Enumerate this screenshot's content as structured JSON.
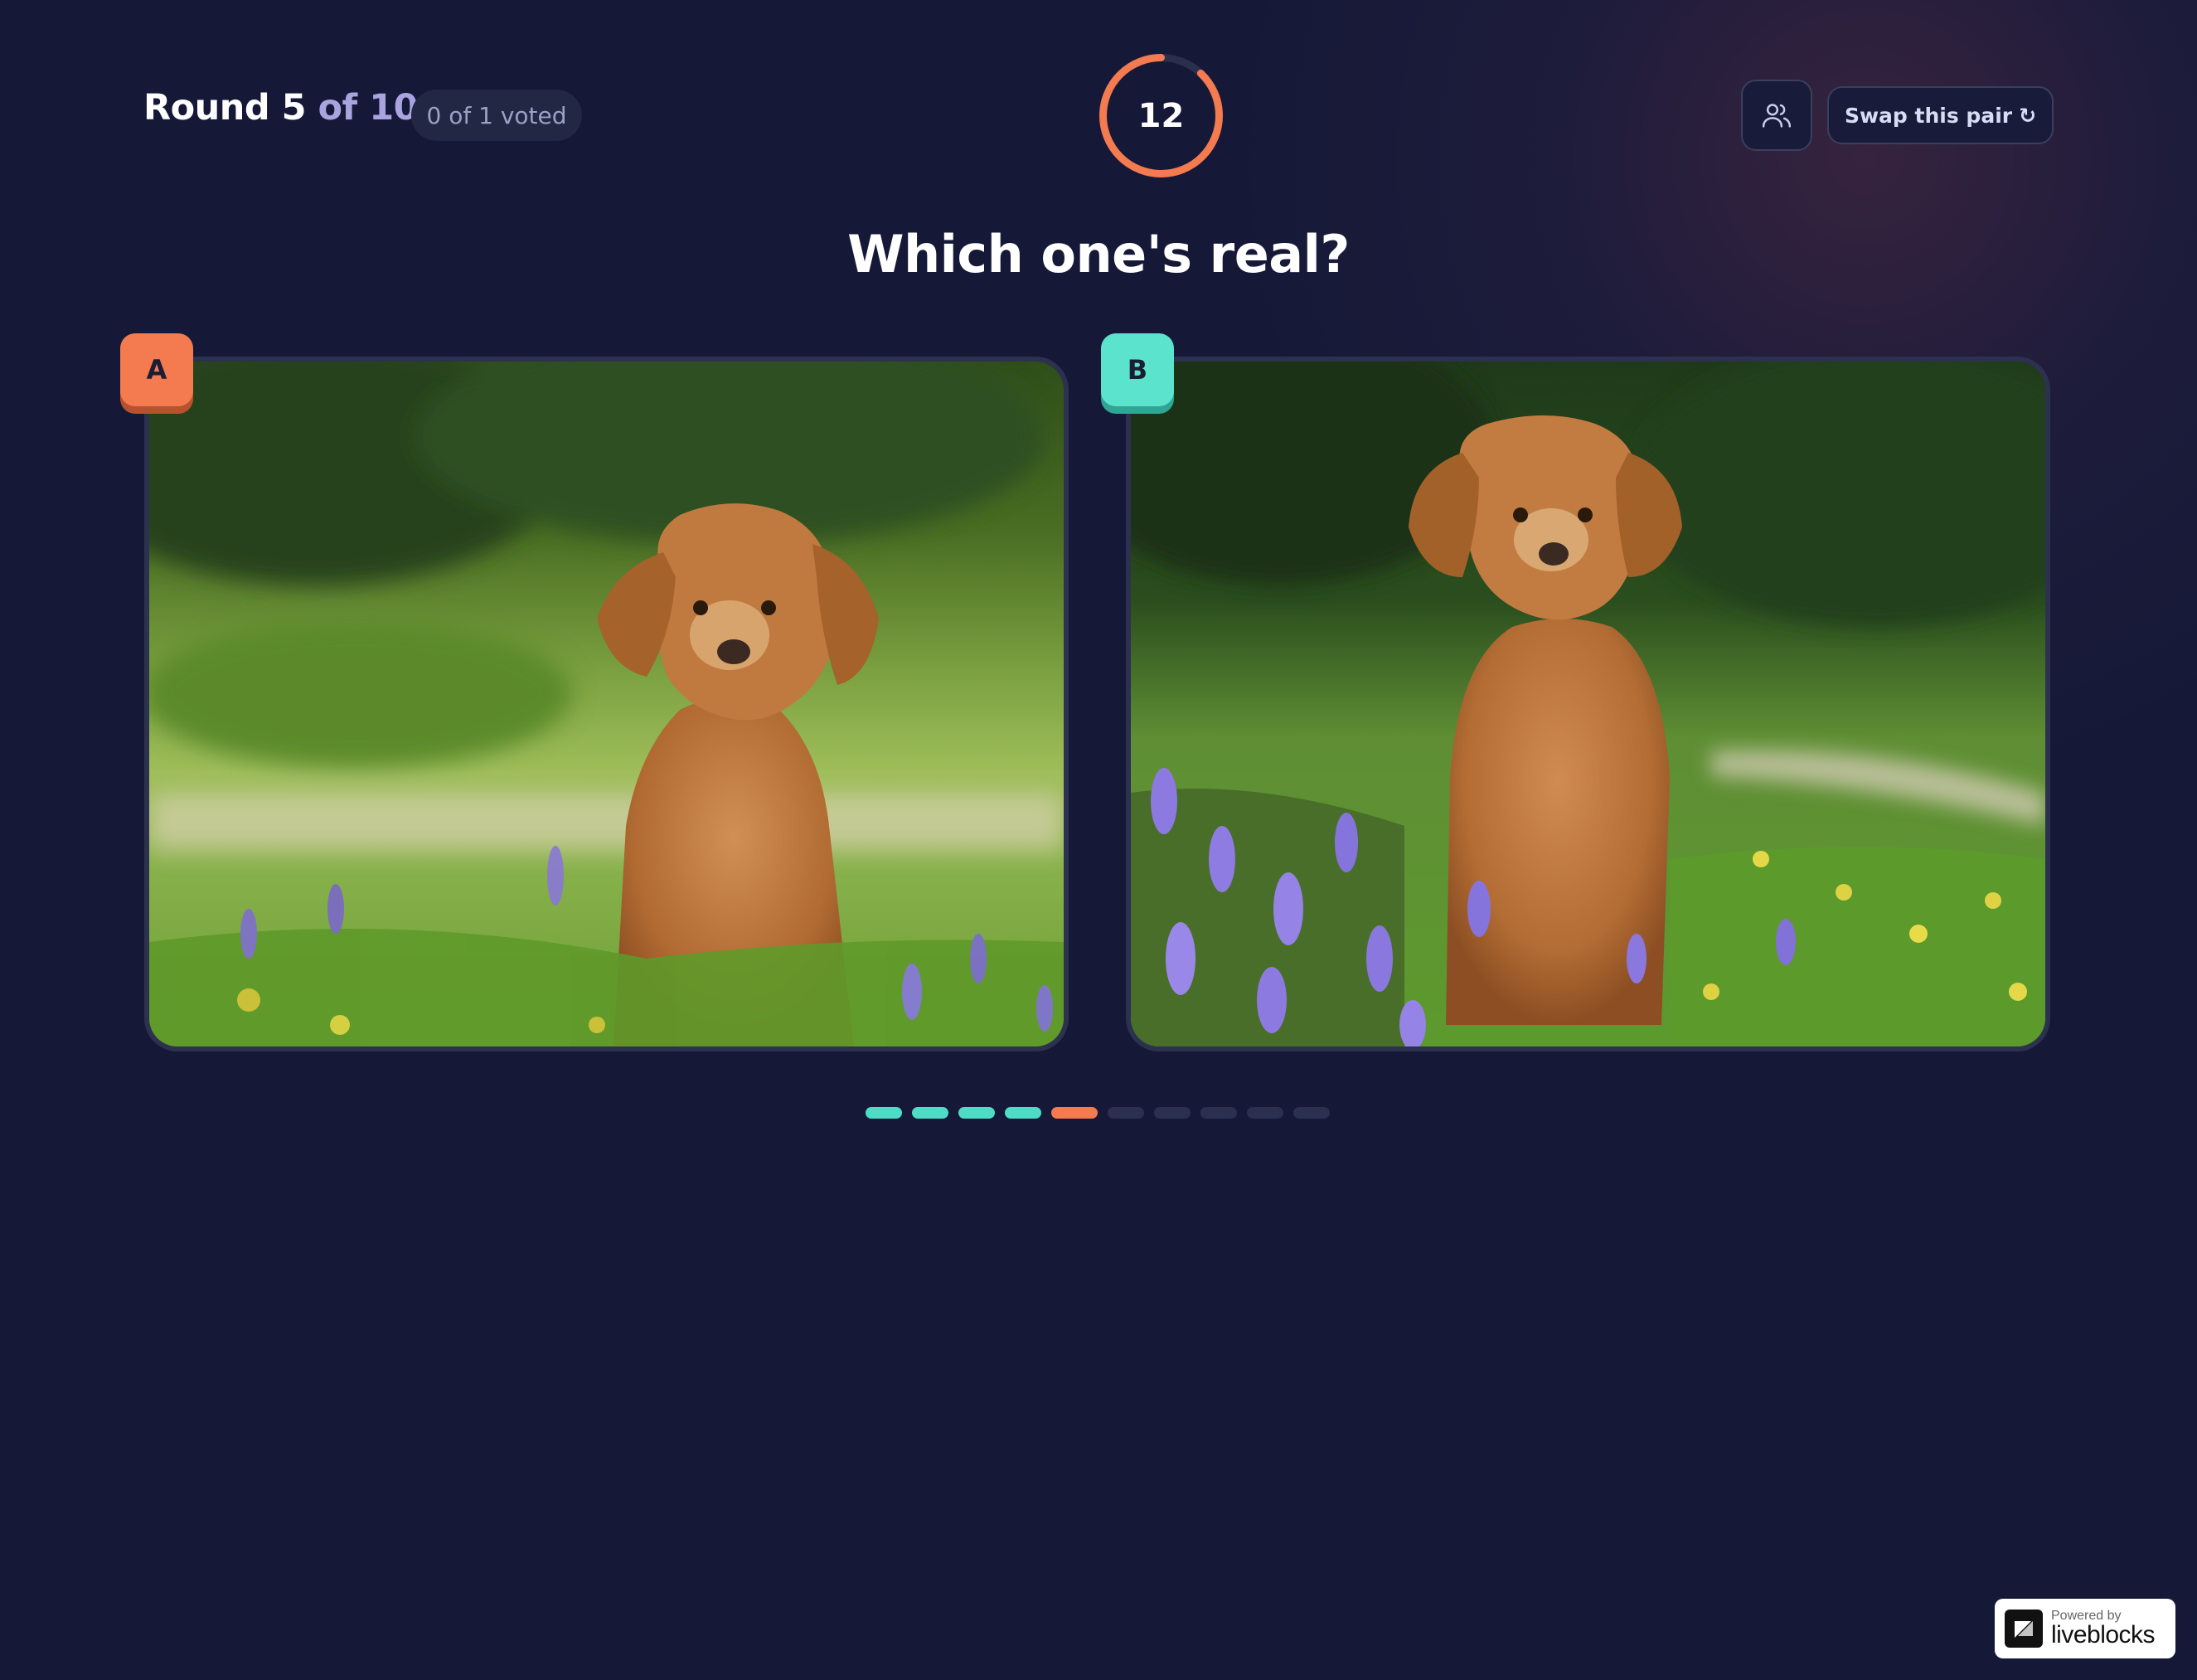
{
  "header": {
    "round_prefix": "Round 5",
    "round_suffix": " of 10",
    "voted_status": "0 of 1 voted",
    "timer_value": "12",
    "timer_remaining_fraction": 0.88,
    "players_icon": "users-icon",
    "swap_label": "Swap this pair",
    "swap_icon": "rotate-icon",
    "swap_glyph": "↻"
  },
  "question": "Which one's real?",
  "options": [
    {
      "badge": "A",
      "color": "#f47a4f"
    },
    {
      "badge": "B",
      "color": "#5ce3cd"
    }
  ],
  "progress": {
    "total": 10,
    "completed": 4,
    "current": 5
  },
  "footer": {
    "powered_by": "Powered by",
    "brand": "liveblocks"
  },
  "colors": {
    "background": "#151937",
    "accent_orange": "#f47a4f",
    "accent_teal": "#5ce3cd"
  }
}
